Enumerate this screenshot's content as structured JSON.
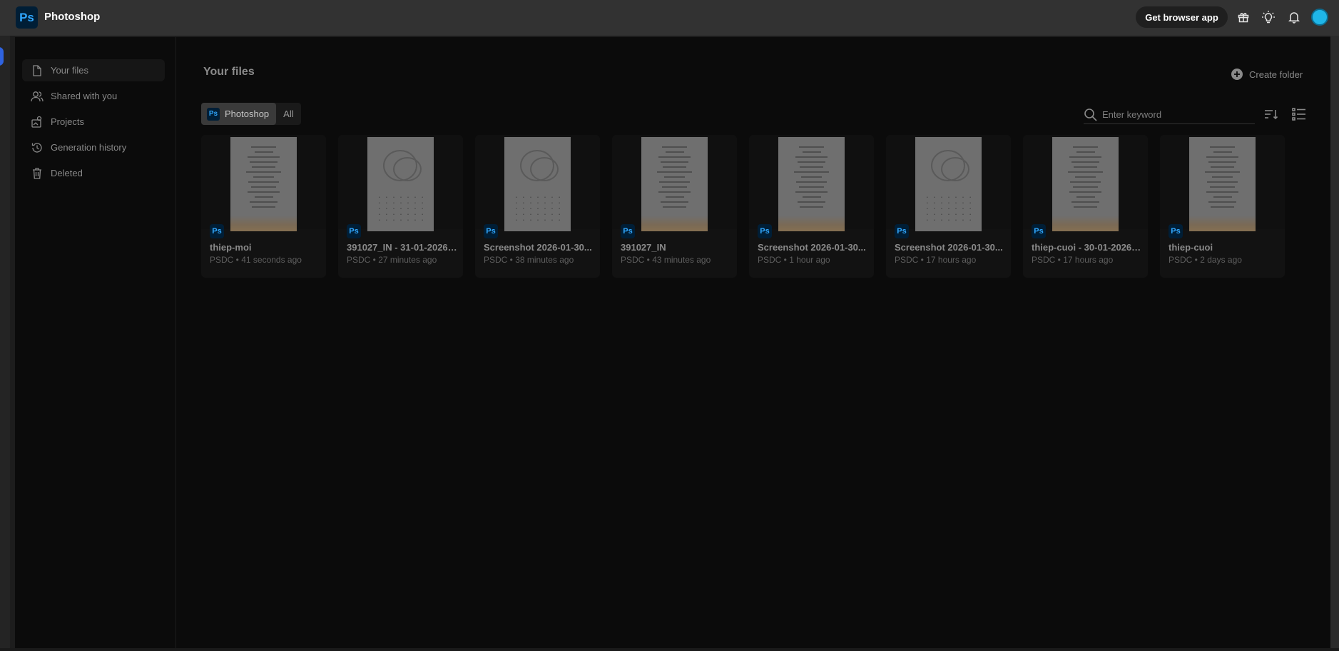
{
  "app": {
    "logo_text": "Ps",
    "title": "Photoshop"
  },
  "header": {
    "get_app_label": "Get browser app"
  },
  "sidebar": {
    "items": [
      {
        "label": "Your files",
        "icon": "file-icon",
        "active": true
      },
      {
        "label": "Shared with you",
        "icon": "users-icon"
      },
      {
        "label": "Projects",
        "icon": "projects-icon"
      },
      {
        "label": "Generation history",
        "icon": "history-icon"
      },
      {
        "label": "Deleted",
        "icon": "trash-icon"
      }
    ]
  },
  "main": {
    "title": "Your files",
    "create_folder_label": "Create folder",
    "filters": [
      {
        "label": "Photoshop",
        "active": true
      },
      {
        "label": "All",
        "active": false
      }
    ],
    "search": {
      "placeholder": "Enter keyword",
      "value": ""
    }
  },
  "files": [
    {
      "name": "thiep-moi",
      "meta": "PSDC • 41 seconds ago",
      "thumb": "invitation"
    },
    {
      "name": "391027_IN - 31-01-2026 0...",
      "meta": "PSDC • 27 minutes ago",
      "thumb": "calendar"
    },
    {
      "name": "Screenshot 2026-01-30...",
      "meta": "PSDC • 38 minutes ago",
      "thumb": "calendar"
    },
    {
      "name": "391027_IN",
      "meta": "PSDC • 43 minutes ago",
      "thumb": "invitation"
    },
    {
      "name": "Screenshot 2026-01-30...",
      "meta": "PSDC • 1 hour ago",
      "thumb": "invitation"
    },
    {
      "name": "Screenshot 2026-01-30...",
      "meta": "PSDC • 17 hours ago",
      "thumb": "calendar"
    },
    {
      "name": "thiep-cuoi - 30-01-2026 1...",
      "meta": "PSDC • 17 hours ago",
      "thumb": "invitation"
    },
    {
      "name": "thiep-cuoi",
      "meta": "PSDC • 2 days ago",
      "thumb": "invitation"
    }
  ],
  "colors": {
    "accent": "#31a8ff",
    "ps_bg": "#001e36",
    "topbar": "#323232",
    "overlay": "#0b0b0b"
  }
}
